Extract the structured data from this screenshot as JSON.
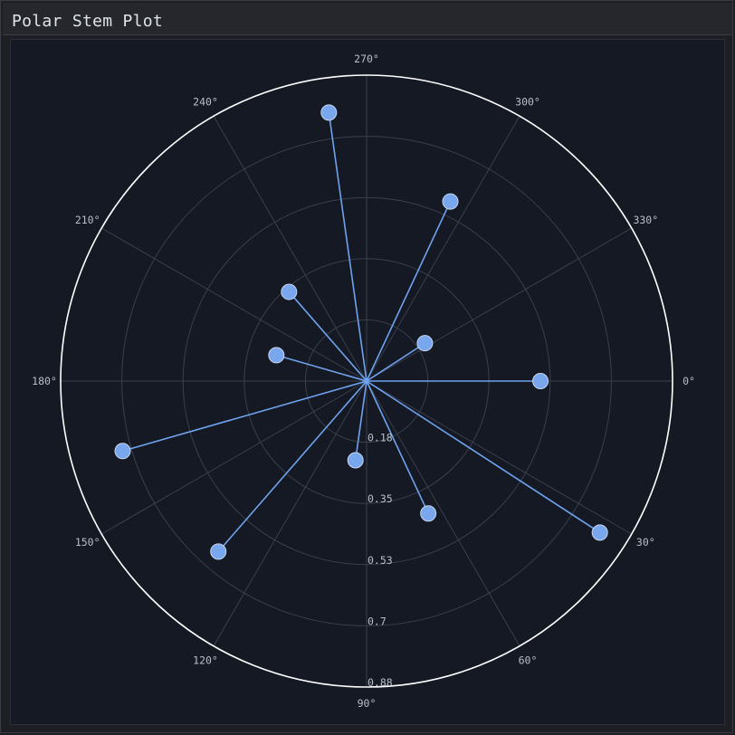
{
  "window": {
    "title": "Polar Stem Plot"
  },
  "colors": {
    "stem": "#6fa3ee",
    "marker_fill": "#79a7ee",
    "marker_edge": "#c8d6ee",
    "grid": "#3a3f4b",
    "outer_ring": "#ffffff"
  },
  "chart_data": {
    "type": "polar-stem",
    "title": "",
    "theta_direction": "clockwise",
    "theta_zero": "right",
    "theta_ticks": [
      "0°",
      "30°",
      "60°",
      "90°",
      "120°",
      "150°",
      "180°",
      "210°",
      "240°",
      "270°",
      "300°",
      "330°"
    ],
    "r_ticks": [
      "0.18",
      "0.35",
      "0.53",
      "0.7",
      "0.88"
    ],
    "r_tick_values": [
      0.176,
      0.352,
      0.528,
      0.704,
      0.88
    ],
    "rlim": [
      0,
      0.88
    ],
    "grid": true,
    "series": [
      {
        "points": [
          {
            "theta": 0,
            "r": 0.5
          },
          {
            "theta": 33,
            "r": 0.8
          },
          {
            "theta": 65,
            "r": 0.42
          },
          {
            "theta": 98,
            "r": 0.23
          },
          {
            "theta": 131,
            "r": 0.65
          },
          {
            "theta": 164,
            "r": 0.73
          },
          {
            "theta": 196,
            "r": 0.27
          },
          {
            "theta": 229,
            "r": 0.34
          },
          {
            "theta": 262,
            "r": 0.78
          },
          {
            "theta": 295,
            "r": 0.57
          },
          {
            "theta": 327,
            "r": 0.2
          }
        ]
      }
    ]
  }
}
